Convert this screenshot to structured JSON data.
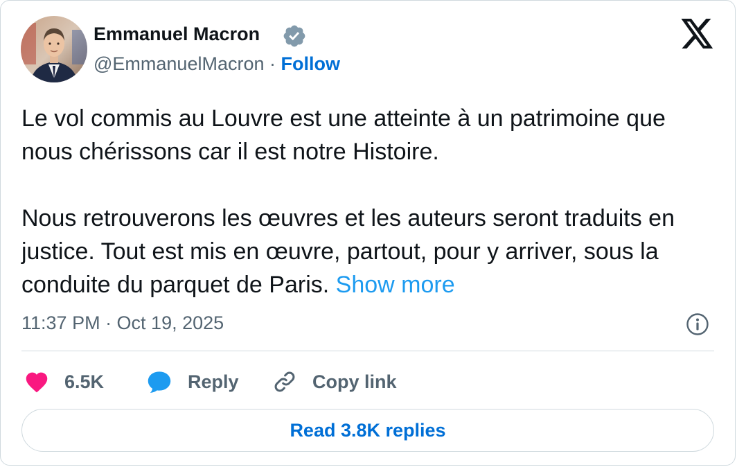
{
  "author": {
    "name": "Emmanuel Macron",
    "handle": "@EmmanuelMacron",
    "separator": " · ",
    "follow_label": "Follow",
    "verified_color": "#829aab"
  },
  "tweet": {
    "paragraph_1": "Le vol commis au Louvre est une atteinte à un patrimoine que nous chérissons car il est notre Histoire.",
    "paragraph_2": "Nous retrouverons les œuvres et les auteurs seront traduits en justice. Tout est mis en œuvre, partout, pour y arriver, sous la conduite du parquet de Paris.",
    "show_more_label": "Show more",
    "timestamp": "11:37 PM · Oct 19, 2025"
  },
  "actions": {
    "like_count": "6.5K",
    "reply_label": "Reply",
    "copy_link_label": "Copy link",
    "read_replies_label": "Read 3.8K replies"
  },
  "colors": {
    "like": "#f91880",
    "reply": "#1d9bf0",
    "link": "#006fd6",
    "text": "#0f1419",
    "secondary": "#536471"
  },
  "icons": [
    "verified-badge-icon",
    "x-logo-icon",
    "info-icon",
    "heart-icon",
    "reply-bubble-icon",
    "link-icon"
  ]
}
